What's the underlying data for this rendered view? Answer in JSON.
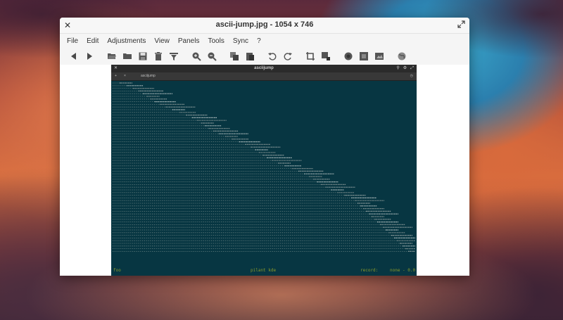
{
  "window": {
    "title": "ascii-jump.jpg  - 1054 x 746"
  },
  "menu": [
    "File",
    "Edit",
    "Adjustments",
    "View",
    "Panels",
    "Tools",
    "Sync",
    "?"
  ],
  "toolbar_icons": [
    "back-arrow-icon",
    "forward-arrow-icon",
    "open-folder-icon",
    "folder-icon",
    "save-icon",
    "delete-icon",
    "filter-icon",
    "zoom-in-icon",
    "zoom-out-icon",
    "copy-icon",
    "paste-icon",
    "rotate-left-icon",
    "rotate-right-icon",
    "crop-icon",
    "resize-icon",
    "record-icon",
    "fullscreen-icon",
    "image-info-icon",
    "globe-icon"
  ],
  "terminal": {
    "title": "asciijump",
    "tab_label": "asciijump",
    "tab_add": "+",
    "tab_close": "×",
    "status": {
      "left": "foo",
      "middle": "pilant kde",
      "record_label": "record:",
      "record_value": "none - 0.0"
    }
  },
  "colors": {
    "terminal_bg": "#073642",
    "terminal_text": "#93a1a1",
    "accent_text": "#8a9a2a",
    "titlebar_bg": "#f7f7f7"
  }
}
